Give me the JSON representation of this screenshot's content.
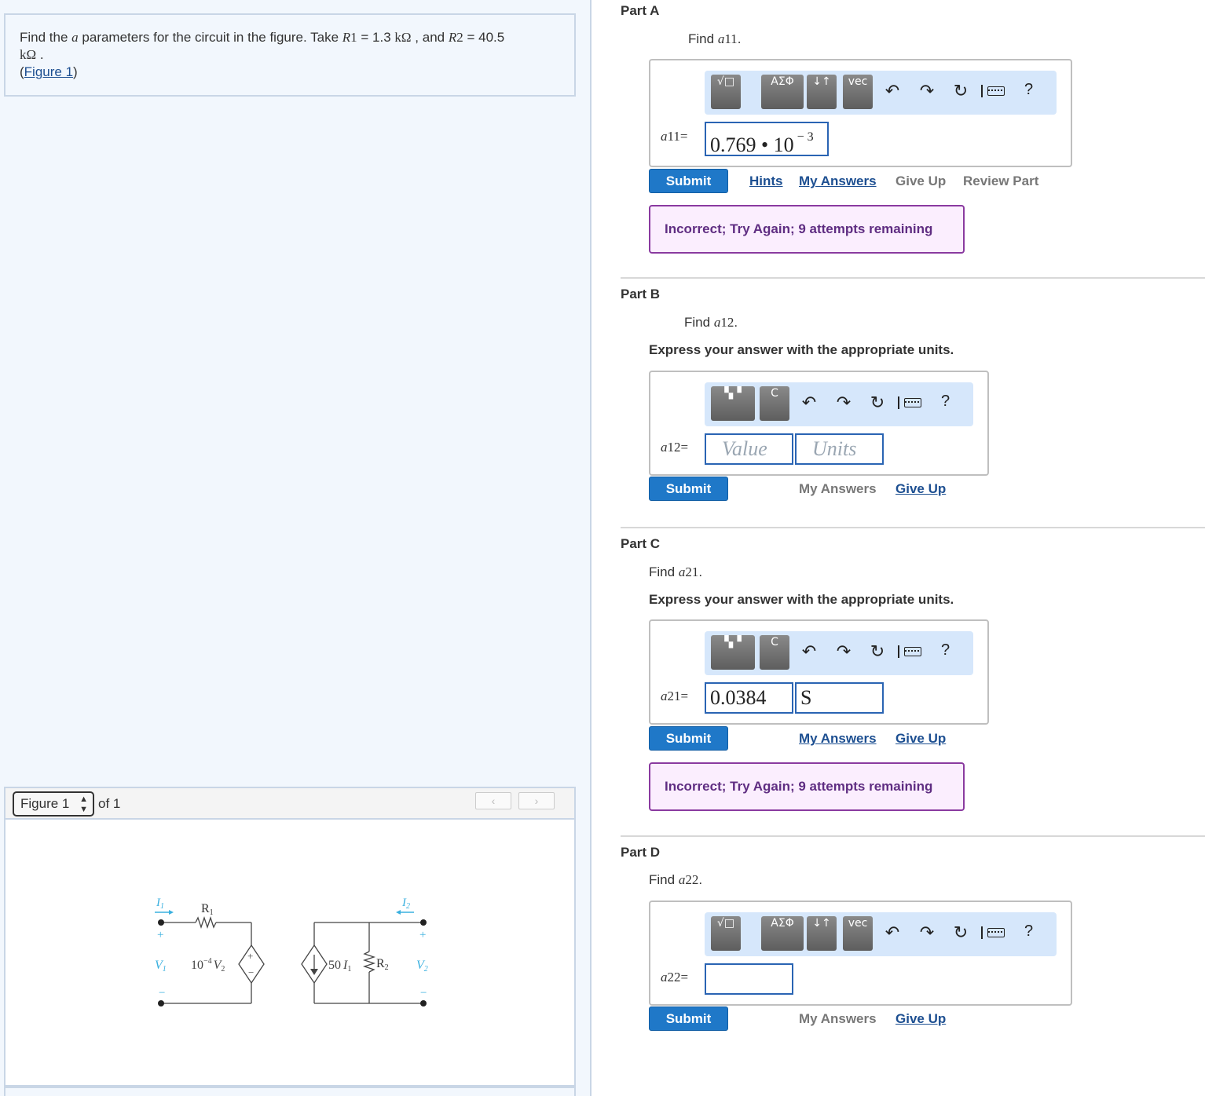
{
  "problem": {
    "text_1": "Find the",
    "var_a": "a",
    "text_2": "parameters for the circuit in the figure. Take",
    "r1_sym": "R",
    "r1_sub": "1",
    "r1_val": "= 1.3",
    "r1_unit": "kΩ",
    "text_3": ", and",
    "r2_sym": "R",
    "r2_sub": "2",
    "r2_val": "= 40.5",
    "r2_unit": "kΩ",
    "text_4": ".",
    "figure_link": "Figure 1"
  },
  "figure": {
    "select_label": "Figure 1",
    "of_text": "of 1",
    "prev": "‹",
    "next": "›",
    "circuit": {
      "i1": "I",
      "i1_sub": "1",
      "r1": "R",
      "r1_sub": "1",
      "v1": "V",
      "v1_sub": "1",
      "dep_v": "10",
      "dep_v_exp": "−4",
      "dep_v_var": "V",
      "dep_v_sub": "2",
      "dep_i": "50",
      "dep_i_var": "I",
      "dep_i_sub": "1",
      "r2": "R",
      "r2_sub": "2",
      "i2": "I",
      "i2_sub": "2",
      "v2": "V",
      "v2_sub": "2",
      "plus": "+",
      "minus": "−"
    }
  },
  "toolbar_icons": {
    "undo": "↶",
    "redo": "↷",
    "reset": "↻",
    "help": "?"
  },
  "parts": {
    "a": {
      "title": "Part A",
      "find": "Find",
      "var": "a",
      "var_sub": "11",
      "period": ".",
      "label": "a",
      "label_sub": "11",
      "eq": "=",
      "answer_mantissa": "0.769 • 10",
      "answer_exp": "− 3",
      "tb": [
        "√□",
        "ΑΣΦ",
        "↓↑",
        "vec"
      ],
      "submit": "Submit",
      "hints": "Hints",
      "my_answers": "My Answers",
      "give_up": "Give Up",
      "review_part": "Review Part",
      "feedback": "Incorrect; Try Again; 9 attempts remaining"
    },
    "b": {
      "title": "Part B",
      "find": "Find",
      "var": "a",
      "var_sub": "12",
      "period": ".",
      "express": "Express your answer with the appropriate units.",
      "label": "a",
      "label_sub": "12",
      "eq": "=",
      "value_placeholder": "Value",
      "units_placeholder": "Units",
      "tb": [
        "▚▝",
        "C"
      ],
      "submit": "Submit",
      "my_answers": "My Answers",
      "give_up": "Give Up"
    },
    "c": {
      "title": "Part C",
      "find": "Find",
      "var": "a",
      "var_sub": "21",
      "period": ".",
      "express": "Express your answer with the appropriate units.",
      "label": "a",
      "label_sub": "21",
      "eq": "=",
      "value": "0.0384",
      "units": "S",
      "tb": [
        "▚▝",
        "C"
      ],
      "submit": "Submit",
      "my_answers": "My Answers",
      "give_up": "Give Up",
      "feedback": "Incorrect; Try Again; 9 attempts remaining"
    },
    "d": {
      "title": "Part D",
      "find": "Find",
      "var": "a",
      "var_sub": "22",
      "period": ".",
      "label": "a",
      "label_sub": "22",
      "eq": "=",
      "tb": [
        "√□",
        "ΑΣΦ",
        "↓↑",
        "vec"
      ],
      "submit": "Submit",
      "my_answers": "My Answers",
      "give_up": "Give Up"
    }
  }
}
